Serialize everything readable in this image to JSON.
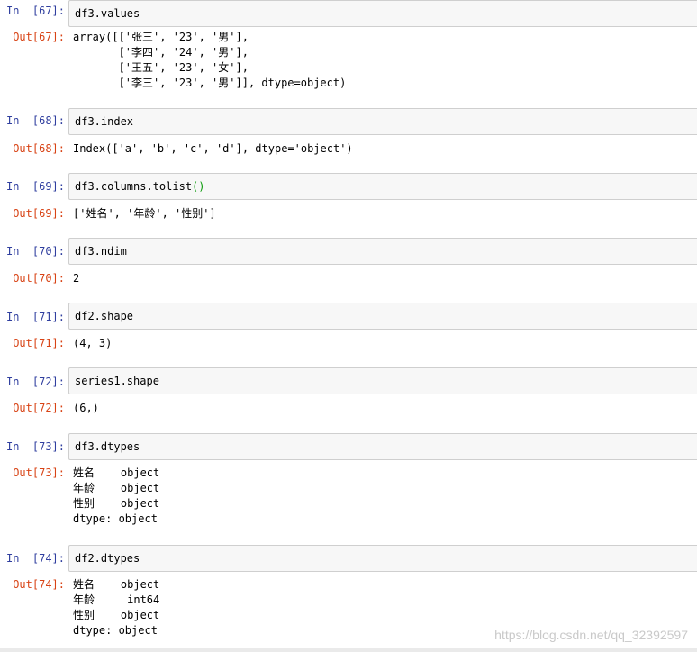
{
  "cells": [
    {
      "in_prompt": "In  [67]:",
      "code": "df3.values",
      "out_prompt": "Out[67]:",
      "output": "array([['张三', '23', '男'],\n       ['李四', '24', '男'],\n       ['王五', '23', '女'],\n       ['李三', '23', '男']], dtype=object)"
    },
    {
      "in_prompt": "In  [68]:",
      "code": "df3.index",
      "out_prompt": "Out[68]:",
      "output": "Index(['a', 'b', 'c', 'd'], dtype='object')"
    },
    {
      "in_prompt": "In  [69]:",
      "code_prefix": "df3.columns.tolist",
      "code_paren": "()",
      "out_prompt": "Out[69]:",
      "output": "['姓名', '年龄', '性别']"
    },
    {
      "in_prompt": "In  [70]:",
      "code": "df3.ndim",
      "out_prompt": "Out[70]:",
      "output": "2"
    },
    {
      "in_prompt": "In  [71]:",
      "code": "df2.shape",
      "out_prompt": "Out[71]:",
      "output": "(4, 3)"
    },
    {
      "in_prompt": "In  [72]:",
      "code": "series1.shape",
      "out_prompt": "Out[72]:",
      "output": "(6,)"
    },
    {
      "in_prompt": "In  [73]:",
      "code": "df3.dtypes",
      "out_prompt": "Out[73]:",
      "output": "姓名    object\n年龄    object\n性别    object\ndtype: object"
    },
    {
      "in_prompt": "In  [74]:",
      "code": "df2.dtypes",
      "out_prompt": "Out[74]:",
      "output": "姓名    object\n年龄     int64\n性别    object\ndtype: object"
    }
  ],
  "watermark": "https://blog.csdn.net/qq_32392597"
}
